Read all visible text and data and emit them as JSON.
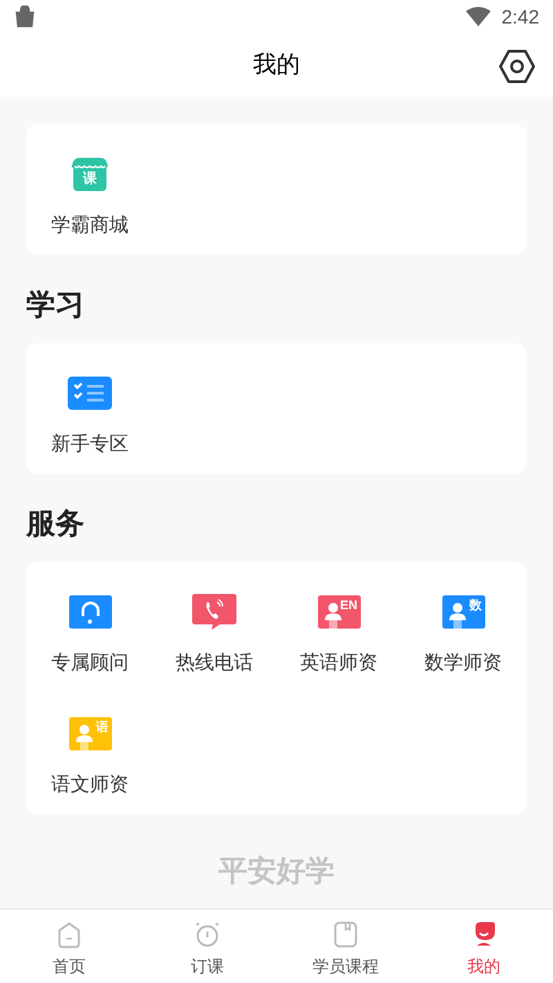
{
  "status_bar": {
    "time": "2:42"
  },
  "header": {
    "title": "我的"
  },
  "sections": [
    {
      "items": [
        {
          "label": "学霸商城",
          "kind": "shop",
          "icon_text": "课",
          "color": "#2ec4a6"
        }
      ]
    },
    {
      "title": "学习",
      "items": [
        {
          "label": "新手专区",
          "kind": "checklist",
          "color": "#1a8cff"
        }
      ]
    },
    {
      "title": "服务",
      "items": [
        {
          "label": "专属顾问",
          "kind": "headset",
          "color": "#1a8cff"
        },
        {
          "label": "热线电话",
          "kind": "phone",
          "color": "#f2566a"
        },
        {
          "label": "英语师资",
          "kind": "teacher",
          "icon_text": "EN",
          "color": "#f2566a"
        },
        {
          "label": "数学师资",
          "kind": "teacher",
          "icon_text": "数",
          "color": "#1a8cff"
        },
        {
          "label": "语文师资",
          "kind": "teacher",
          "icon_text": "语",
          "color": "#ffc107"
        }
      ]
    }
  ],
  "footer_brand": "平安好学",
  "nav": [
    {
      "label": "首页",
      "kind": "home",
      "selected": false
    },
    {
      "label": "订课",
      "kind": "clock",
      "selected": false
    },
    {
      "label": "学员课程",
      "kind": "book",
      "selected": false
    },
    {
      "label": "我的",
      "kind": "me",
      "selected": true
    }
  ]
}
